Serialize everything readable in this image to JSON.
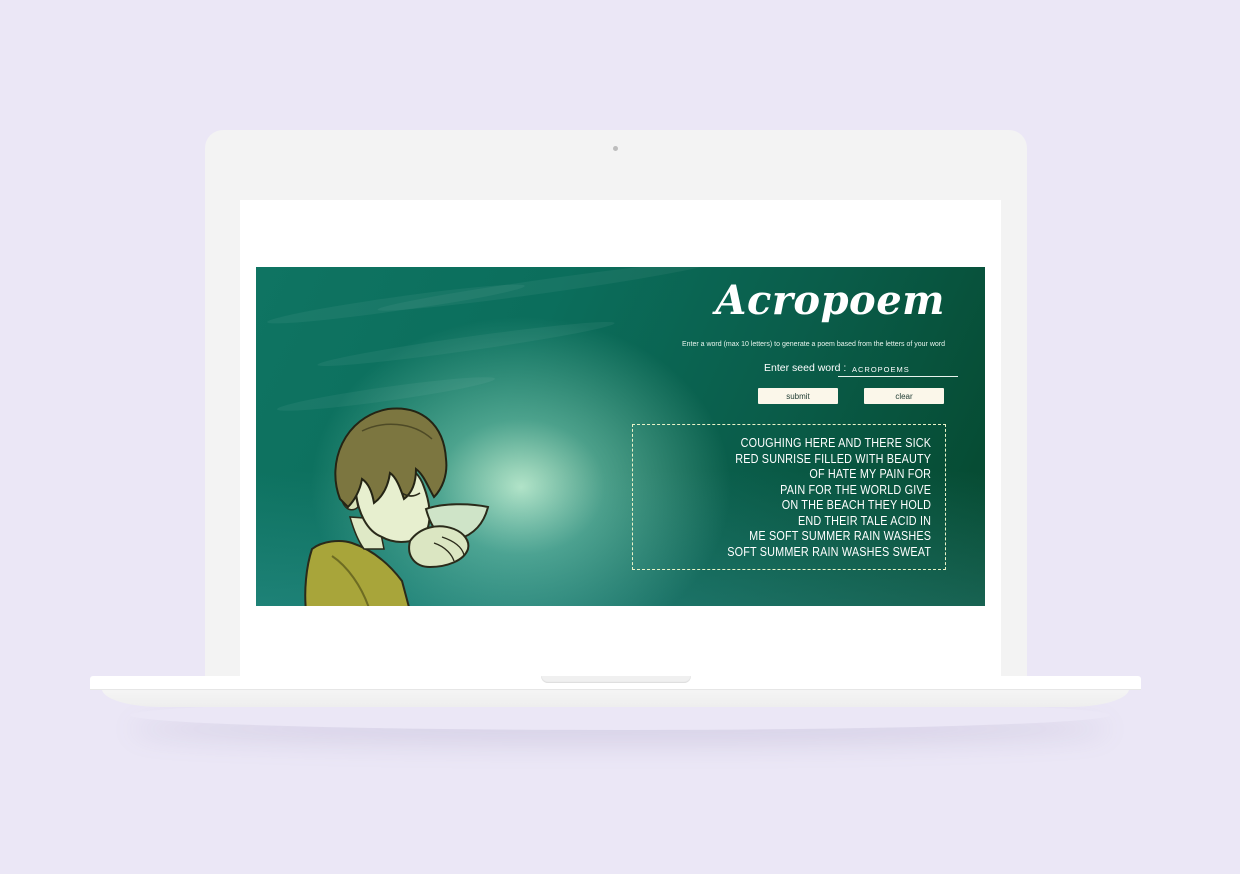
{
  "app": {
    "title": "Acropoem",
    "instructions": "Enter a word (max 10 letters) to generate a poem based from the letters of your word"
  },
  "form": {
    "seed_label": "Enter seed word :",
    "seed_value": "ACROPOEMS",
    "submit_label": "submit",
    "clear_label": "clear"
  },
  "poem": {
    "lines": [
      "COUGHING HERE AND THERE SICK",
      "RED SUNRISE FILLED WITH BEAUTY",
      "OF HATE MY PAIN FOR",
      "PAIN FOR THE WORLD GIVE",
      "ON THE BEACH THEY HOLD",
      "END THEIR TALE ACID IN",
      "ME SOFT SUMMER RAIN WASHES",
      "SOFT SUMMER RAIN WASHES SWEAT"
    ]
  },
  "colors": {
    "background": "#ebe7f6",
    "banner_dark": "#05472d",
    "banner_teal": "#0f7462",
    "button_bg": "#fbf7ea",
    "poem_border": "#eaf3c8"
  },
  "icons": {
    "illustration": "child-drinking-from-cup-illustration"
  }
}
